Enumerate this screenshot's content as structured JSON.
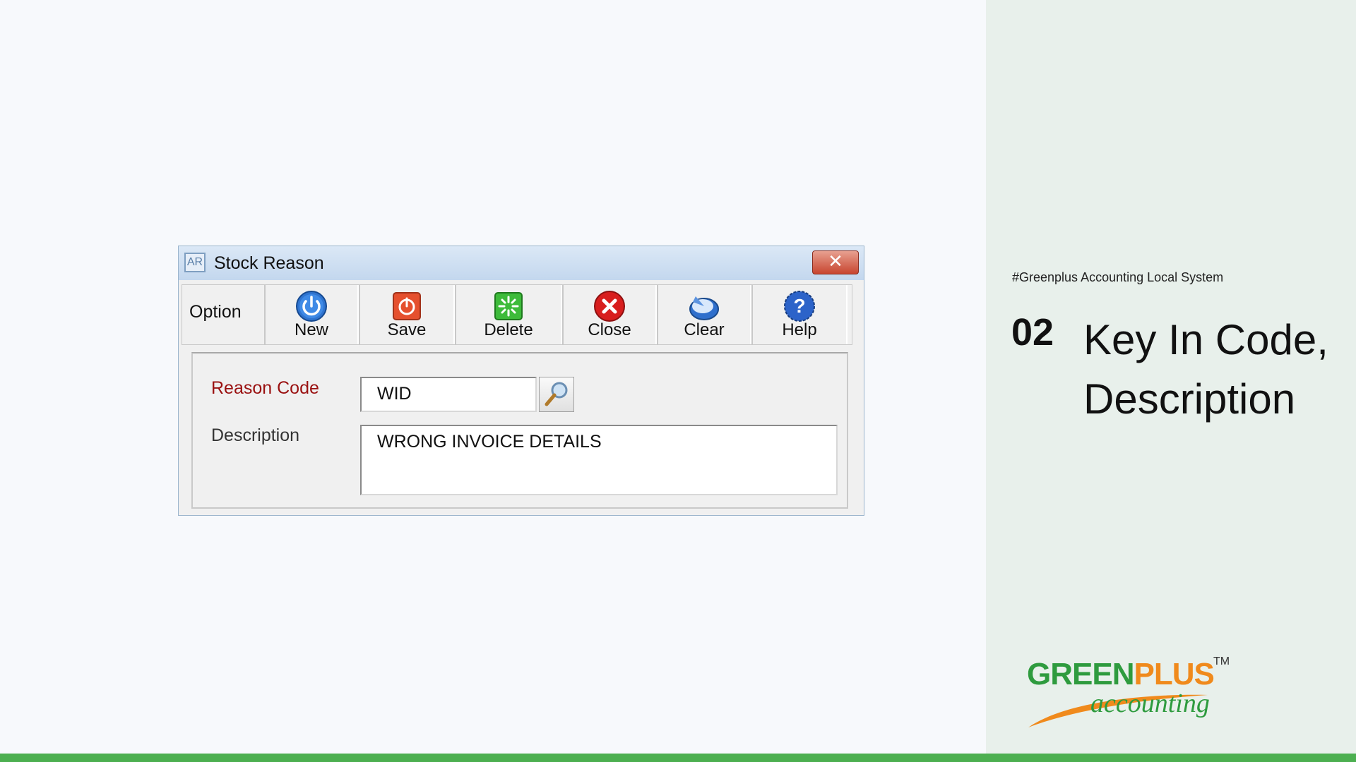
{
  "slide": {
    "tagline": "#Greenplus Accounting Local System",
    "step_number": "02",
    "step_title_line1": "Key In Code,",
    "step_title_line2": "Description"
  },
  "logo": {
    "brand_green": "GREEN",
    "brand_orange": "PLUS",
    "tm": "TM",
    "sub": "accounting",
    "colors": {
      "green": "#2e9b3e",
      "orange": "#f08a1c"
    }
  },
  "dialog": {
    "app_icon": "AR",
    "title": "Stock Reason",
    "close_glyph": "✕",
    "toolbar": {
      "option_label": "Option",
      "buttons": [
        {
          "label": "New",
          "icon": "power-icon"
        },
        {
          "label": "Save",
          "icon": "save-icon"
        },
        {
          "label": "Delete",
          "icon": "delete-icon"
        },
        {
          "label": "Close",
          "icon": "close-circle-icon"
        },
        {
          "label": "Clear",
          "icon": "clear-icon"
        },
        {
          "label": "Help",
          "icon": "help-icon"
        }
      ]
    },
    "form": {
      "reason_code_label": "Reason Code",
      "reason_code_value": "WID",
      "description_label": "Description",
      "description_value": "WRONG INVOICE DETAILS"
    }
  },
  "colors": {
    "panel_bg": "#e8f0eb",
    "bottom_bar": "#4caf50",
    "required_label": "#9a1111"
  }
}
